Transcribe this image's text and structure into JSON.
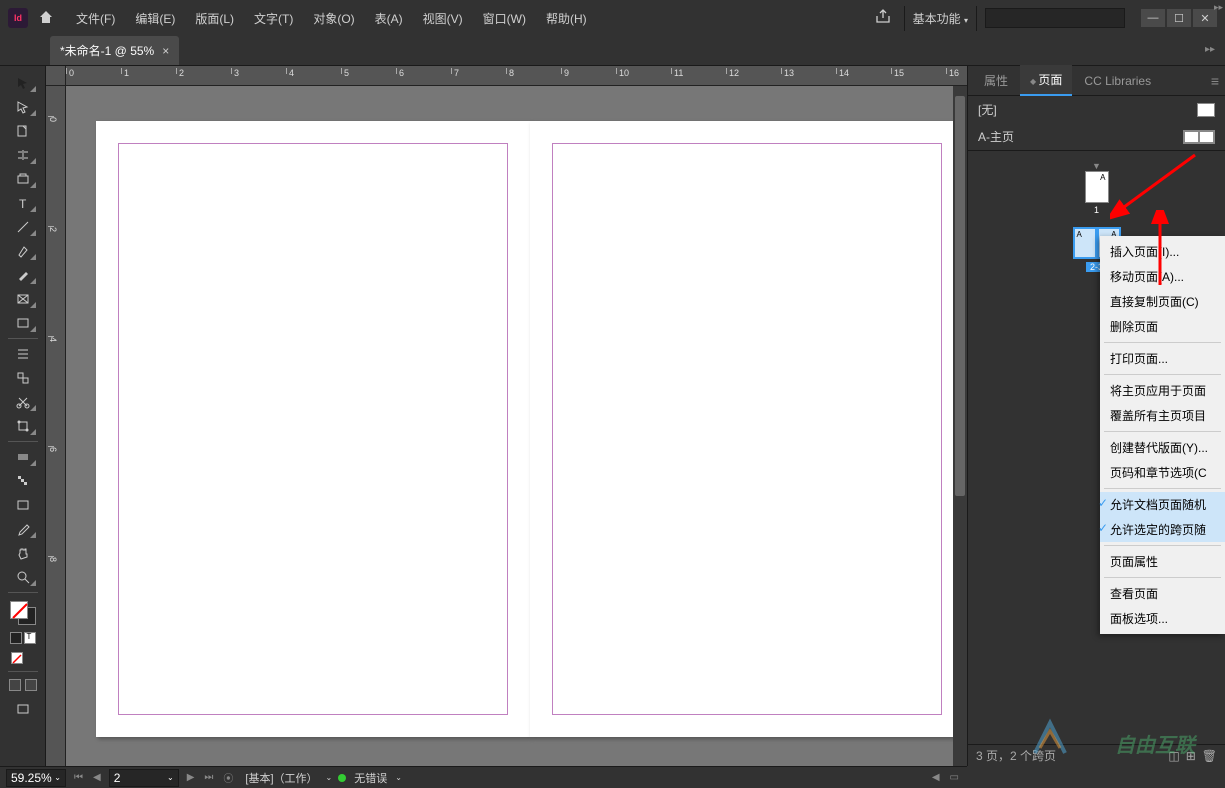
{
  "app": {
    "id_badge": "Id"
  },
  "menu": {
    "file": "文件(F)",
    "edit": "编辑(E)",
    "layout": "版面(L)",
    "type": "文字(T)",
    "object": "对象(O)",
    "table": "表(A)",
    "view": "视图(V)",
    "window": "窗口(W)",
    "help": "帮助(H)"
  },
  "workspace": {
    "label": "基本功能"
  },
  "document": {
    "tab_title": "*未命名-1 @ 55%"
  },
  "ruler": {
    "h": [
      "0",
      "1",
      "2",
      "3",
      "4",
      "5",
      "6",
      "7",
      "8",
      "9",
      "10",
      "11",
      "12",
      "13",
      "14",
      "15",
      "16"
    ],
    "v": [
      "0",
      "2",
      "4",
      "6",
      "8"
    ]
  },
  "panels": {
    "props": "属性",
    "pages": "页面",
    "cc": "CC Libraries",
    "none_master": "[无]",
    "a_master": "A-主页",
    "page1_label": "1",
    "pageA": "A",
    "spread_label": "2-3",
    "footer_text": "3 页，2 个跨页"
  },
  "context": {
    "insert": "插入页面(I)...",
    "move": "移动页面(A)...",
    "duplicate": "直接复制页面(C)",
    "delete": "删除页面",
    "print": "打印页面...",
    "apply_master": "将主页应用于页面",
    "override": "覆盖所有主页项目",
    "alt_layout": "创建替代版面(Y)...",
    "numbering": "页码和章节选项(C",
    "allow_shuffle": "允许文档页面随机",
    "allow_spread": "允许选定的跨页随",
    "page_attr": "页面属性",
    "view_pages": "查看页面",
    "panel_opts": "面板选项..."
  },
  "status": {
    "zoom": "59.25%",
    "page": "2",
    "style_group": "[基本]（工作）",
    "errors": "无错误"
  },
  "watermark": "自由互联"
}
